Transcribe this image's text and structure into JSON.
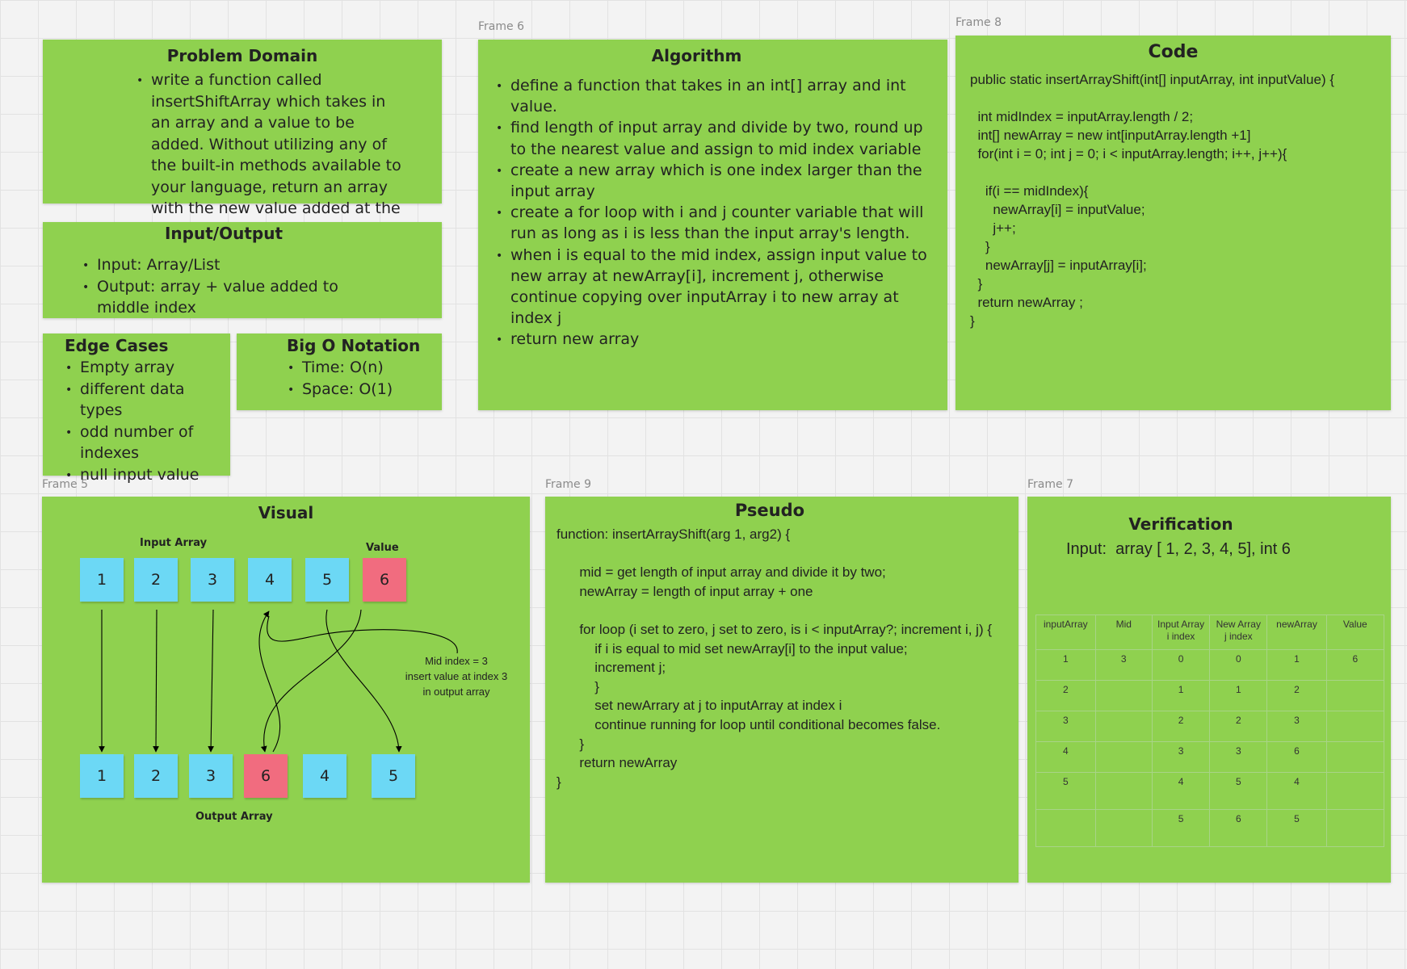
{
  "frames": {
    "frame6": "Frame 6",
    "frame8": "Frame 8",
    "frame5": "Frame 5",
    "frame9": "Frame 9",
    "frame7": "Frame 7"
  },
  "problem_domain": {
    "title": "Problem Domain",
    "items": [
      "write a function called insertShiftArray which takes in an array and a value to be added. Without utilizing any of the built-in methods available to your language, return an array with the new value added at the middle index"
    ]
  },
  "input_output": {
    "title": "Input/Output",
    "items": [
      "Input: Array/List",
      "Output: array + value added to middle index"
    ]
  },
  "edge_cases": {
    "title": "Edge Cases",
    "items": [
      "Empty array",
      "different data types",
      "odd number of indexes",
      "null input value"
    ]
  },
  "big_o": {
    "title": "Big O Notation",
    "items": [
      "Time: O(n)",
      "Space: O(1)"
    ]
  },
  "algorithm": {
    "title": "Algorithm",
    "items": [
      "define a function that takes in an int[] array and int value.",
      "find length of input array and divide by two, round up to the nearest value and assign to mid index variable",
      "create a new array which is one index larger than the input array",
      "create a for loop with i and j counter variable that will run as long as i is less than the input array's length.",
      "when i is equal to the mid index, assign input value to new array at newArray[i], increment j, otherwise continue copying over inputArray i to new array at index j",
      "return new array"
    ]
  },
  "code": {
    "title": "Code",
    "lines": [
      "public static insertArrayShift(int[] inputArray, int inputValue) {",
      "",
      "  int midIndex = inputArray.length / 2;",
      "  int[] newArray = new int[inputArray.length +1]",
      "  for(int i = 0; int j = 0; i < inputArray.length; i++, j++){",
      "",
      "    if(i == midIndex){",
      "      newArray[i] = inputValue;",
      "      j++;",
      "    }",
      "    newArray[j] = inputArray[i];",
      "  }",
      "  return newArray ;",
      "}"
    ]
  },
  "visual": {
    "title": "Visual",
    "input_label": "Input Array",
    "value_label": "Value",
    "output_label": "Output Array",
    "input_values": [
      "1",
      "2",
      "3",
      "4",
      "5"
    ],
    "value": "6",
    "output_values": [
      "1",
      "2",
      "3",
      "6",
      "4",
      "5"
    ],
    "note_lines": [
      "Mid index = 3",
      "insert value at index 3",
      "in output array"
    ]
  },
  "pseudo": {
    "title": "Pseudo",
    "lines": [
      "function: insertArrayShift(arg 1, arg2) {",
      "",
      "      mid = get length of input array and divide it by two;",
      "      newArray = length of input array + one",
      "",
      "      for loop (i set to zero, j set to zero, is i < inputArray?; increment i, j) {",
      "          if i is equal to mid set newArray[i] to the input value;",
      "          increment j;",
      "          }",
      "          set newArrary at j to inputArray at index i",
      "          continue running for loop until conditional becomes false.",
      "      }",
      "      return newArray",
      "}"
    ]
  },
  "verification": {
    "title": "Verification",
    "input_line": "Input:  array [ 1, 2, 3, 4, 5], int 6",
    "headers": [
      "inputArray",
      "Mid",
      "Input Array\ni index",
      "New Array\nj index",
      "newArray",
      "Value"
    ],
    "rows": [
      [
        "1",
        "3",
        "0",
        "0",
        "1",
        "6"
      ],
      [
        "2",
        "",
        "1",
        "1",
        "2",
        ""
      ],
      [
        "3",
        "",
        "2",
        "2",
        "3",
        ""
      ],
      [
        "4",
        "",
        "3",
        "3",
        "6",
        ""
      ],
      [
        "5",
        "",
        "4",
        "5",
        "4",
        ""
      ],
      [
        "",
        "",
        "5",
        "6",
        "5",
        ""
      ]
    ]
  }
}
